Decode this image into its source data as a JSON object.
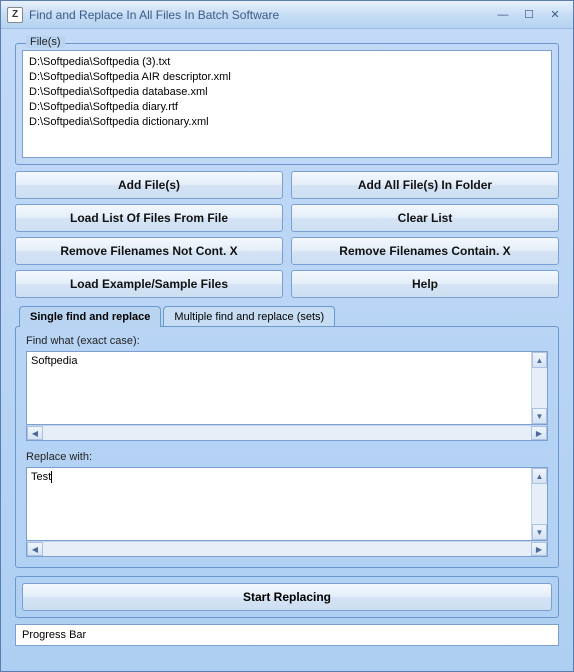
{
  "window": {
    "title": "Find and Replace In All Files In Batch Software",
    "icon_letter": "Z"
  },
  "filelist": {
    "label": "File(s)",
    "items": [
      "D:\\Softpedia\\Softpedia (3).txt",
      "D:\\Softpedia\\Softpedia AIR descriptor.xml",
      "D:\\Softpedia\\Softpedia database.xml",
      "D:\\Softpedia\\Softpedia diary.rtf",
      "D:\\Softpedia\\Softpedia dictionary.xml"
    ]
  },
  "buttons": {
    "add_files": "Add File(s)",
    "add_all_folder": "Add All File(s) In Folder",
    "load_list": "Load List Of Files From File",
    "clear_list": "Clear List",
    "remove_not_cont": "Remove Filenames Not Cont. X",
    "remove_contain": "Remove Filenames Contain. X",
    "load_example": "Load Example/Sample Files",
    "help": "Help"
  },
  "tabs": {
    "single": "Single find and replace",
    "multiple": "Multiple find and replace (sets)"
  },
  "find": {
    "label": "Find what (exact case):",
    "value": "Softpedia"
  },
  "replace": {
    "label": "Replace with:",
    "value": "Test"
  },
  "start_button": "Start Replacing",
  "progress_label": "Progress Bar"
}
